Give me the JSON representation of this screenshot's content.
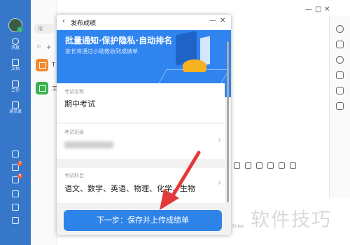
{
  "rail": {
    "items": [
      {
        "label": "消息",
        "icon": "chat-icon"
      },
      {
        "label": "文档",
        "icon": "document-icon"
      },
      {
        "label": "工作",
        "icon": "workbench-icon"
      },
      {
        "label": "通讯录",
        "icon": "contacts-icon"
      }
    ],
    "badges": [
      "3",
      "8"
    ]
  },
  "chat_list": {
    "search_placeholder": "搜",
    "items": [
      {
        "name": "T",
        "color": "#f08a2c"
      },
      {
        "name": "工",
        "color": "#37b24d"
      }
    ]
  },
  "main": {
    "window_controls": [
      "—",
      "□",
      "✕"
    ],
    "hint": "Enter"
  },
  "modal": {
    "title": "发布成绩",
    "back": "‹",
    "min": "—",
    "close": "✕",
    "banner": {
      "headline": "批量通知·保护隐私·自动排名",
      "subline": "家长将通过小助教收到成绩单"
    },
    "fields": {
      "exam_name_label": "考试名称",
      "exam_name_value": "期中考试",
      "class_label": "考试班级",
      "subject_label": "考试科目",
      "subject_value": "语文、数学、英语、物理、化学、生物"
    },
    "next_button": "下一步：保存并上传成绩单"
  },
  "watermark": "软件技巧",
  "colors": {
    "rail": "#3677c9",
    "banner": "#2f84f0",
    "button": "#2e83e8",
    "arrow": "#e23a3a"
  }
}
